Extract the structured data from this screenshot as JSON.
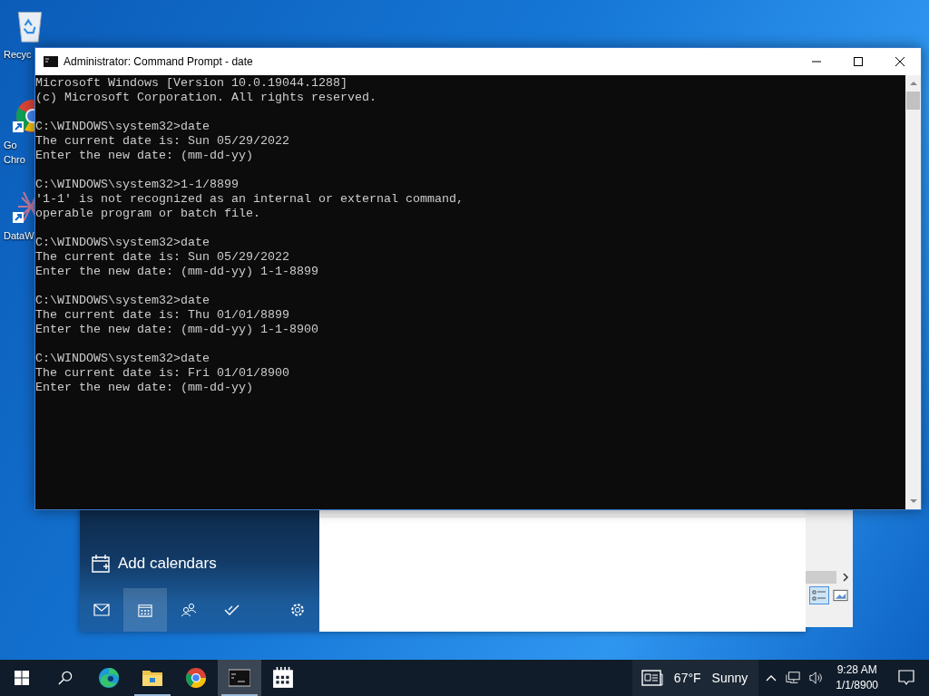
{
  "desktop_icons": [
    {
      "kind": "recycle",
      "lines": [
        "Recyc"
      ]
    },
    {
      "kind": "chrome",
      "lines": [
        "Go",
        "Chro"
      ]
    },
    {
      "kind": "data",
      "lines": [
        "DataW"
      ]
    }
  ],
  "calendar_window": {
    "add_label": "Add calendars",
    "nav": [
      {
        "kind": "mail",
        "selected": false
      },
      {
        "kind": "calendar",
        "selected": true
      },
      {
        "kind": "people",
        "selected": false
      },
      {
        "kind": "todo",
        "selected": false
      },
      {
        "kind": "settings",
        "selected": false
      }
    ]
  },
  "window": {
    "title": "Administrator: Command Prompt - date",
    "console": [
      [
        "Microsoft Windows [Version 10.0.19044.1288]",
        "(c) Microsoft Corporation. All rights reserved."
      ],
      [
        "C:\\WINDOWS\\system32>date",
        "The current date is: Sun 05/29/2022",
        "Enter the new date: (mm-dd-yy)"
      ],
      [
        "C:\\WINDOWS\\system32>1-1/8899",
        "'1-1' is not recognized as an internal or external command,",
        "operable program or batch file."
      ],
      [
        "C:\\WINDOWS\\system32>date",
        "The current date is: Sun 05/29/2022",
        "Enter the new date: (mm-dd-yy) 1-1-8899"
      ],
      [
        "C:\\WINDOWS\\system32>date",
        "The current date is: Thu 01/01/8899",
        "Enter the new date: (mm-dd-yy) 1-1-8900"
      ],
      [
        "C:\\WINDOWS\\system32>date",
        "The current date is: Fri 01/01/8900",
        "Enter the new date: (mm-dd-yy)"
      ]
    ]
  },
  "taskbar": {
    "apps": [
      {
        "kind": "edge",
        "selected": false,
        "running": false
      },
      {
        "kind": "explorer",
        "selected": false,
        "running": true
      },
      {
        "kind": "chrome",
        "selected": false,
        "running": false
      },
      {
        "kind": "cmd",
        "selected": true,
        "running": true
      },
      {
        "kind": "calendar",
        "selected": false,
        "running": false
      }
    ],
    "weather": {
      "temperature": "67°F",
      "condition": "Sunny"
    },
    "time": "9:28 AM",
    "date": "1/1/8900"
  }
}
